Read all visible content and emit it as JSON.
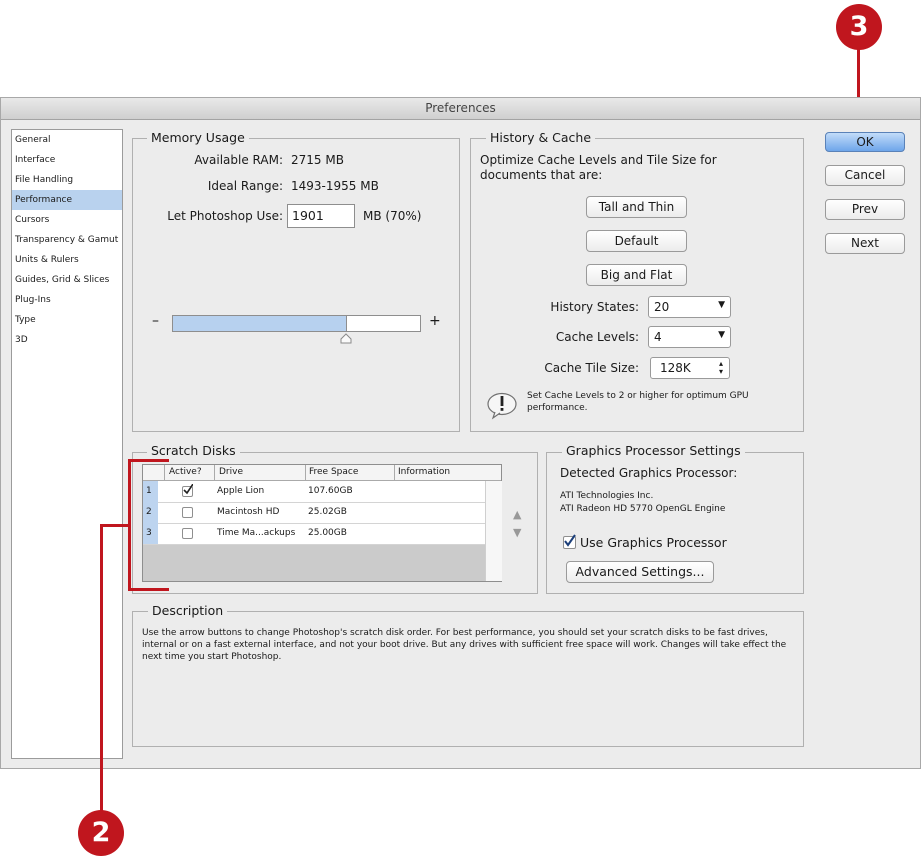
{
  "window": {
    "title": "Preferences"
  },
  "sidebar": {
    "items": [
      {
        "label": "General"
      },
      {
        "label": "Interface"
      },
      {
        "label": "File Handling"
      },
      {
        "label": "Performance"
      },
      {
        "label": "Cursors"
      },
      {
        "label": "Transparency & Gamut"
      },
      {
        "label": "Units & Rulers"
      },
      {
        "label": "Guides, Grid & Slices"
      },
      {
        "label": "Plug-Ins"
      },
      {
        "label": "Type"
      },
      {
        "label": "3D"
      }
    ],
    "selected": "Performance"
  },
  "memory": {
    "title": "Memory Usage",
    "available_label": "Available RAM:",
    "available_value": "2715 MB",
    "ideal_label": "Ideal Range:",
    "ideal_value": "1493-1955 MB",
    "let_label": "Let Photoshop Use:",
    "let_value": "1901",
    "let_suffix": "MB (70%)",
    "minus": "–",
    "plus": "+",
    "slider_fraction": 0.7
  },
  "history": {
    "title": "History & Cache",
    "optimize_text": "Optimize Cache Levels and Tile Size for documents that are:",
    "btn_tall": "Tall and Thin",
    "btn_default": "Default",
    "btn_big": "Big and Flat",
    "states_label": "History States:",
    "states_value": "20",
    "levels_label": "Cache Levels:",
    "levels_value": "4",
    "tile_label": "Cache Tile Size:",
    "tile_value": "128K",
    "note": "Set Cache Levels to 2 or higher for optimum GPU performance."
  },
  "scratch": {
    "title": "Scratch Disks",
    "headers": {
      "active": "Active?",
      "drive": "Drive",
      "free": "Free Space",
      "info": "Information"
    },
    "rows": [
      {
        "num": "1",
        "active": true,
        "drive": "Apple Lion",
        "free": "107.60GB",
        "info": ""
      },
      {
        "num": "2",
        "active": false,
        "drive": "Macintosh HD",
        "free": "25.02GB",
        "info": ""
      },
      {
        "num": "3",
        "active": false,
        "drive": "Time Ma...ackups",
        "free": "25.00GB",
        "info": ""
      }
    ]
  },
  "gpu": {
    "title": "Graphics Processor Settings",
    "detected_label": "Detected Graphics Processor:",
    "vendor": "ATI Technologies Inc.",
    "model": "ATI Radeon HD 5770 OpenGL Engine",
    "use_label": "Use Graphics Processor",
    "use_checked": true,
    "advanced_btn": "Advanced Settings..."
  },
  "description": {
    "title": "Description",
    "text": "Use the arrow buttons to change Photoshop's scratch disk order. For best performance, you should set your scratch disks to be fast drives, internal or on a fast external interface, and not your boot drive. But any drives with sufficient free space will work. Changes will take effect the next time you start Photoshop."
  },
  "buttons": {
    "ok": "OK",
    "cancel": "Cancel",
    "prev": "Prev",
    "next": "Next"
  },
  "callouts": {
    "top": "3",
    "bottom": "2"
  },
  "colors": {
    "callout": "#c0161e",
    "selection": "#b9d2ee",
    "default_button": "#6ea5ea"
  }
}
